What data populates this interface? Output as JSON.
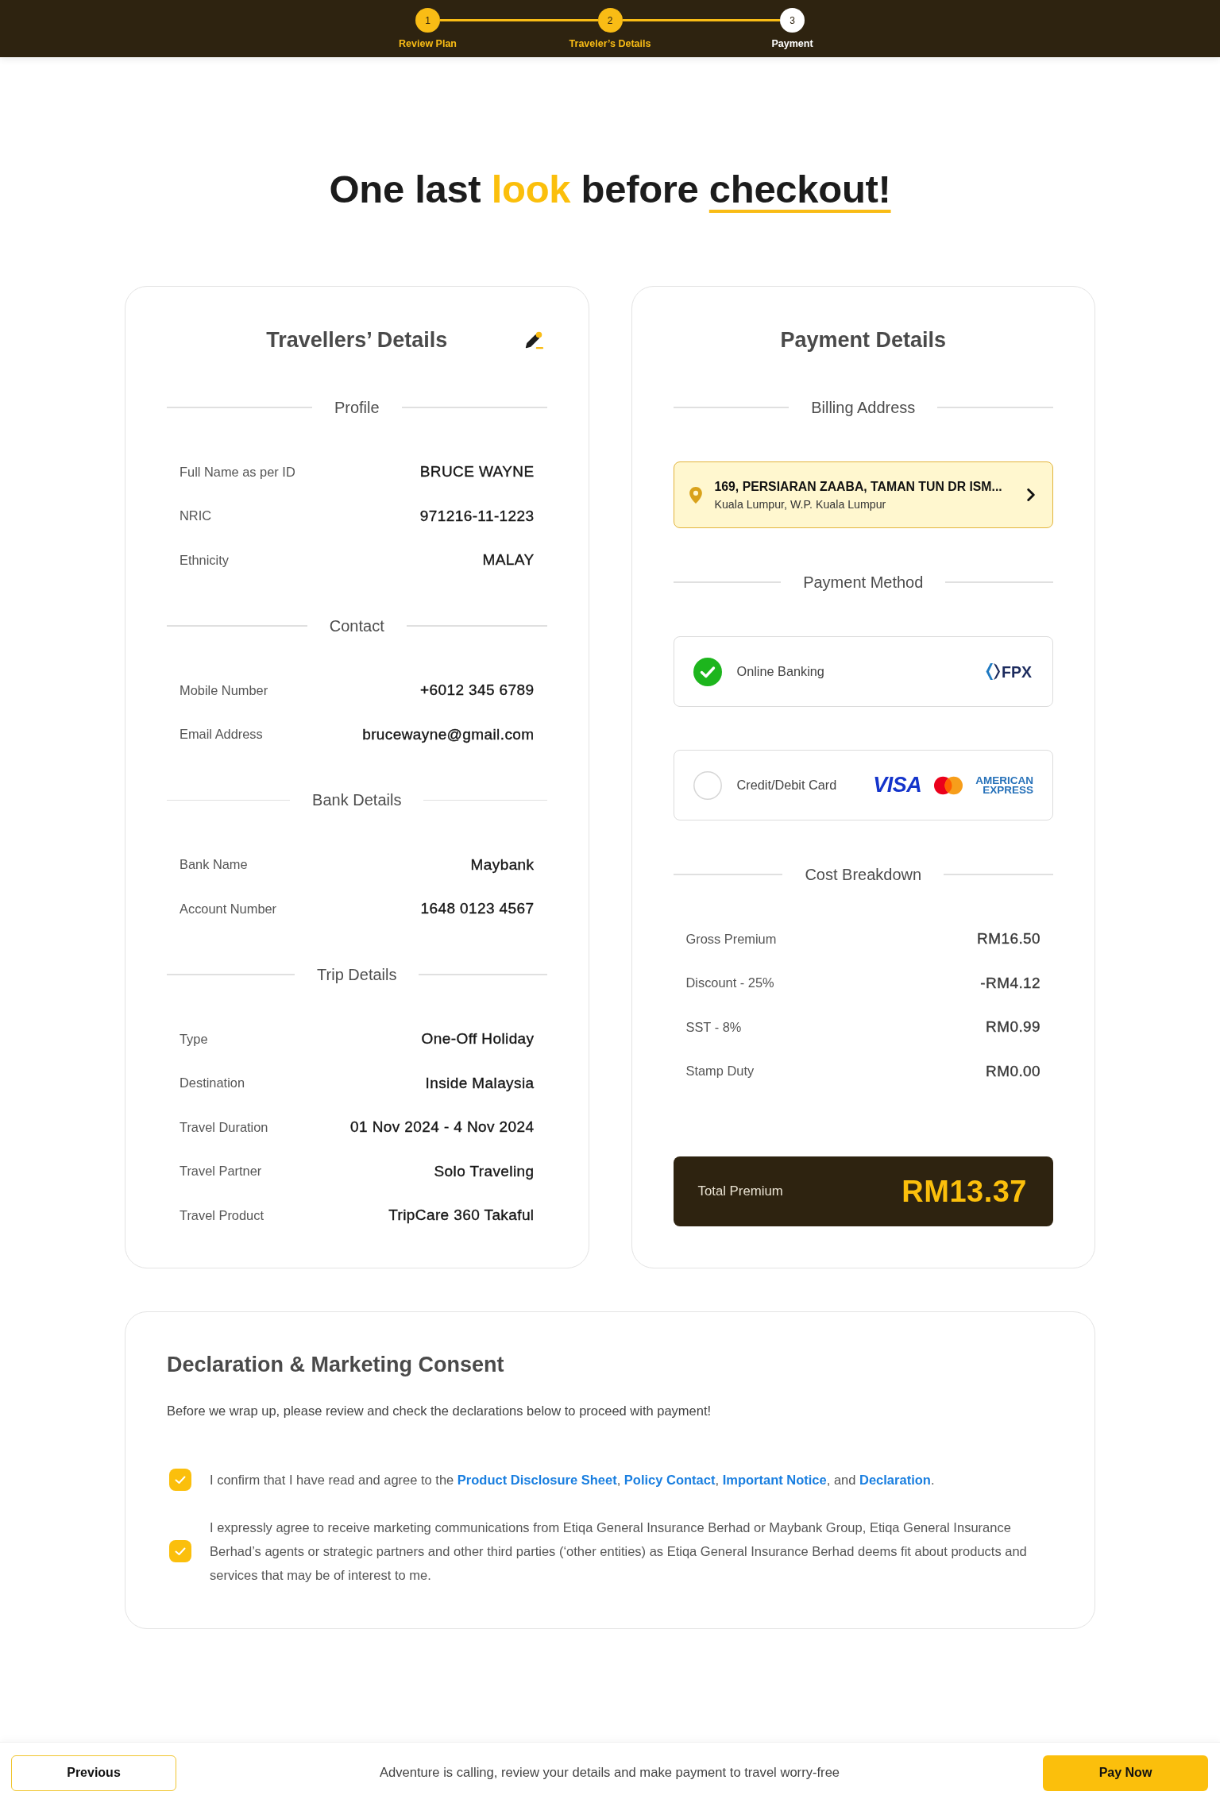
{
  "stepper": {
    "steps": [
      {
        "number": "1",
        "label": "Review Plan",
        "completed": true
      },
      {
        "number": "2",
        "label": "Traveler’s Details",
        "completed": true
      },
      {
        "number": "3",
        "label": "Payment",
        "completed": false
      }
    ]
  },
  "heading": {
    "parts": [
      {
        "kind": "plain",
        "text": "One last "
      },
      {
        "kind": "highlight",
        "text": "look"
      },
      {
        "kind": "plain",
        "text": " before "
      },
      {
        "kind": "underline",
        "text": "checkout!"
      }
    ]
  },
  "travellers_details": {
    "title": "Travellers’ Details",
    "sections": [
      {
        "title": "Profile",
        "rows": [
          {
            "label": "Full Name as per ID",
            "value": "BRUCE WAYNE"
          },
          {
            "label": "NRIC",
            "value": "971216-11-1223"
          },
          {
            "label": "Ethnicity",
            "value": "MALAY"
          }
        ]
      },
      {
        "title": "Contact",
        "rows": [
          {
            "label": "Mobile Number",
            "value": "+6012 345 6789"
          },
          {
            "label": "Email Address",
            "value": "brucewayne@gmail.com"
          }
        ]
      },
      {
        "title": "Bank Details",
        "rows": [
          {
            "label": "Bank Name",
            "value": "Maybank"
          },
          {
            "label": "Account Number",
            "value": "1648 0123 4567"
          }
        ]
      },
      {
        "title": "Trip Details",
        "rows": [
          {
            "label": "Type",
            "value": "One-Off Holiday"
          },
          {
            "label": "Destination",
            "value": "Inside Malaysia"
          },
          {
            "label": "Travel Duration",
            "value": "01 Nov 2024 - 4 Nov 2024"
          },
          {
            "label": "Travel Partner",
            "value": "Solo Traveling"
          },
          {
            "label": "Travel Product",
            "value": "TripCare 360 Takaful"
          }
        ]
      }
    ]
  },
  "payment_details": {
    "title": "Payment Details",
    "billing_address": {
      "heading": "Billing Address",
      "street": "169, PERSIARAN ZAABA, TAMAN TUN DR ISM...",
      "city": "Kuala Lumpur, W.P. Kuala Lumpur"
    },
    "payment_method": {
      "heading": "Payment Method",
      "options": [
        {
          "label": "Online Banking",
          "selected": true,
          "logos": [
            {
              "kind": "fpx",
              "text": "FPX"
            }
          ]
        },
        {
          "label": "Credit/Debit Card",
          "selected": false,
          "logos": [
            {
              "kind": "visa",
              "text": "VISA"
            },
            {
              "kind": "mastercard"
            },
            {
              "kind": "amex",
              "text": "AMERICAN EXPRESS"
            }
          ]
        }
      ]
    },
    "cost_breakdown": {
      "heading": "Cost Breakdown",
      "items": [
        {
          "label": "Gross Premium",
          "value": "RM16.50"
        },
        {
          "label": "Discount - 25%",
          "value": "-RM4.12"
        },
        {
          "label": "SST - 8%",
          "value": "RM0.99"
        },
        {
          "label": "Stamp Duty",
          "value": "RM0.00"
        }
      ],
      "total": {
        "label": "Total Premium",
        "value": "RM13.37"
      }
    }
  },
  "declaration": {
    "title": "Declaration & Marketing Consent",
    "intro": "Before we wrap up, please review and check the declarations below to proceed with payment!",
    "items": [
      {
        "checked": true,
        "parts": [
          {
            "kind": "text",
            "text": "I confirm that I have read and agree to the "
          },
          {
            "kind": "link",
            "text": "Product Disclosure Sheet"
          },
          {
            "kind": "text",
            "text": ", "
          },
          {
            "kind": "link",
            "text": "Policy Contact"
          },
          {
            "kind": "text",
            "text": ", "
          },
          {
            "kind": "link",
            "text": "Important Notice"
          },
          {
            "kind": "text",
            "text": ", and "
          },
          {
            "kind": "link",
            "text": "Declaration"
          },
          {
            "kind": "text",
            "text": "."
          }
        ]
      },
      {
        "checked": true,
        "parts": [
          {
            "kind": "text",
            "text": "I expressly agree to receive marketing communications from Etiqa General Insurance Berhad or Maybank Group, Etiqa General Insurance Berhad’s agents or strategic partners and other third parties (‘other entities) as Etiqa General Insurance Berhad deems fit about products and services that may be of interest to me."
          }
        ]
      }
    ]
  },
  "footer": {
    "previous_button": "Previous",
    "message": "Adventure is calling, review your details and make payment to travel worry-free",
    "pay_button": "Pay Now"
  }
}
